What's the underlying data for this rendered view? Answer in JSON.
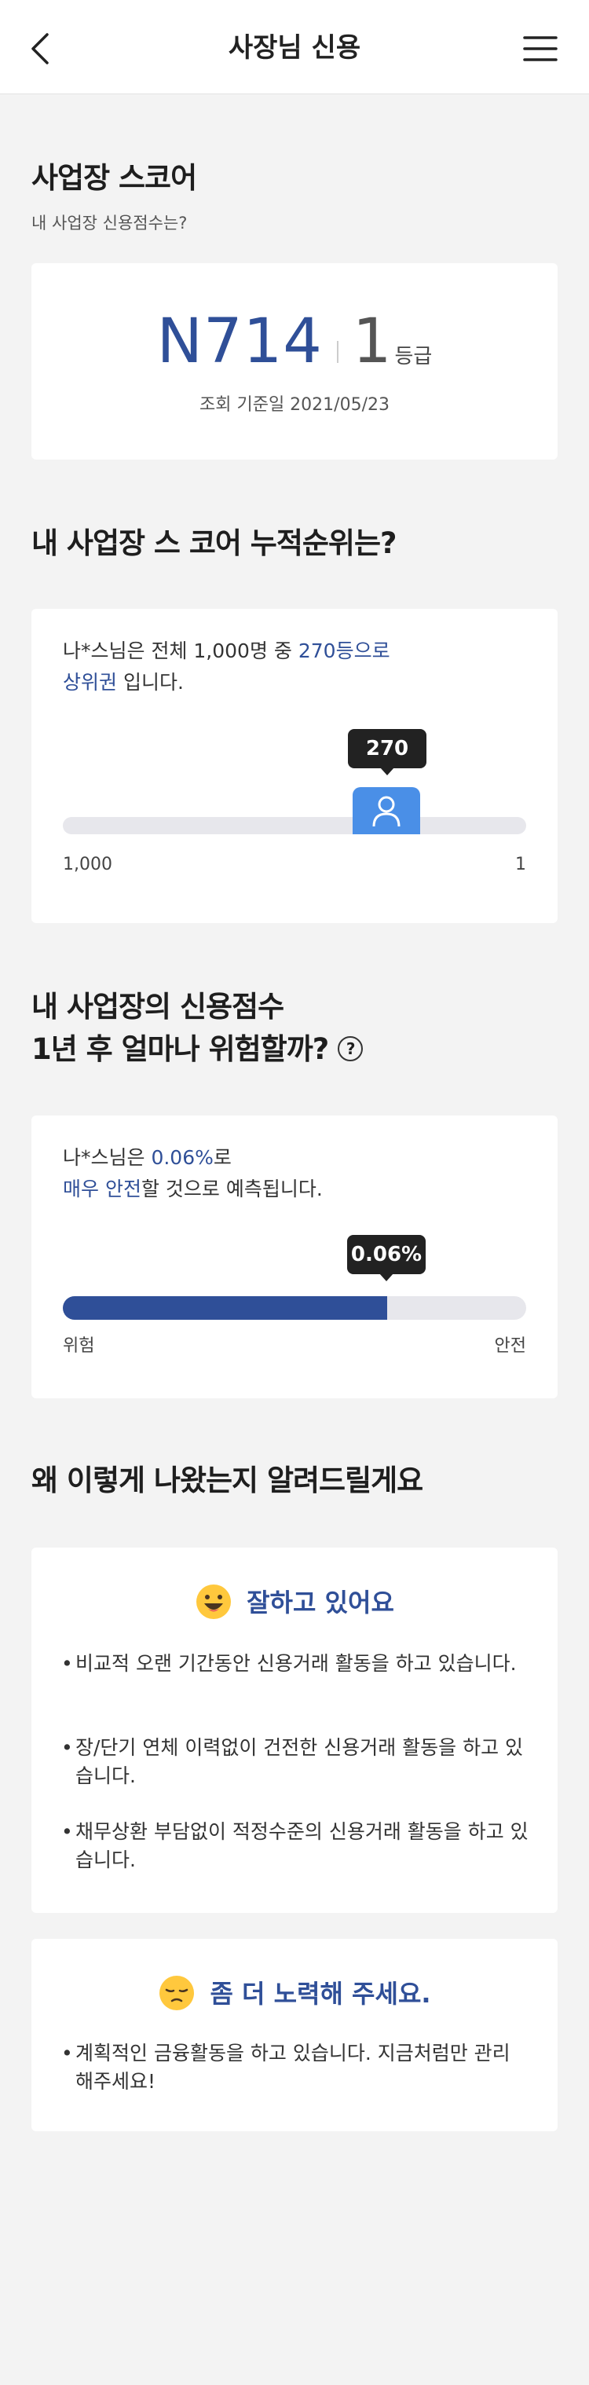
{
  "header": {
    "title": "사장님 신용",
    "back_icon": "chevron-left-icon",
    "menu_icon": "hamburger-menu-icon"
  },
  "score_section": {
    "title": "사업장 스코어",
    "subtitle": "내 사업장 신용점수는?",
    "score": "N714",
    "grade": "1",
    "grade_unit": "등급",
    "date_text": "조회 기준일 2021/05/23"
  },
  "rank_section": {
    "title": "내 사업장 스 코어 누적순위는?",
    "text_prefix": "나*스님은 전체 1,000명 중 ",
    "text_highlight1": "270등으로",
    "text_highlight2": "상위권",
    "text_suffix": " 입니다.",
    "tooltip": "270",
    "rank": 270,
    "total": 1000,
    "axis_left": "1,000",
    "axis_right": "1",
    "marker_icon": "user-icon"
  },
  "risk_section": {
    "title_line1": "내 사업장의 신용점수",
    "title_line2": "1년 후 얼마나 위험할까?",
    "help_icon": "question-circle-icon",
    "help_glyph": "?",
    "text_prefix": "나*스님은 ",
    "text_highlight1": "0.06%",
    "text_mid": "로",
    "text_highlight2": "매우 안전",
    "text_suffix": "할 것으로 예측됩니다.",
    "tooltip": "0.06%",
    "safety_fraction": 0.7,
    "axis_left": "위험",
    "axis_right": "안전"
  },
  "reason_section": {
    "title": "왜 이렇게 나왔는지 알려드릴게요",
    "good": {
      "emoji_icon": "grinning-face-icon",
      "heading": "잘하고 있어요",
      "items": [
        "비교적 오랜 기간동안 신용거래 활동을 하고 있습니다.",
        "장/단기 연체 이력없이 건전한 신용거래 활동을 하고 있습니다.",
        "채무상환 부담없이 적정수준의 신용거래 활동을 하고 있습니다."
      ]
    },
    "improve": {
      "emoji_icon": "pensive-face-icon",
      "heading": "좀 더 노력해 주세요.",
      "items": [
        "계획적인 금융활동을 하고 있습니다. 지금처럼만 관리 해주세요!"
      ]
    }
  },
  "colors": {
    "accent": "#2f4f98",
    "marker": "#4a8fe7",
    "track": "#e7e7ec",
    "background": "#f3f3f3"
  }
}
